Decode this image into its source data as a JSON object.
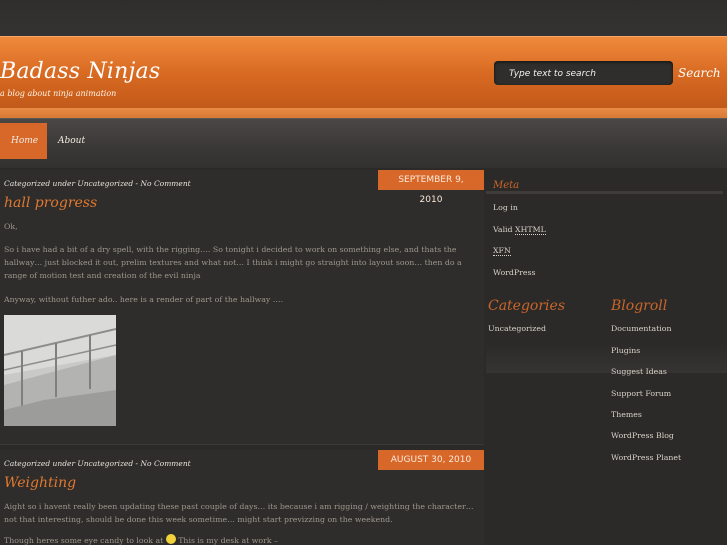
{
  "site": {
    "title": "Badass Ninjas",
    "tagline": "a blog about ninja animation"
  },
  "search": {
    "placeholder": "Type text to search",
    "button_label": "Search"
  },
  "nav": {
    "items": [
      {
        "label": "Home",
        "active": true
      },
      {
        "label": "About",
        "active": false
      }
    ]
  },
  "posts": [
    {
      "meta": "Categorized under Uncategorized - No Comment",
      "date": "SEPTEMBER 9, 2010",
      "title": "hall progress",
      "paragraphs": [
        "Ok,",
        "So i have had a bit of a dry spell, with the rigging…. So tonight i decided to work on something else, and thats the hallway… just blocked it out, prelim textures and what not… I think i might go straight into layout soon… then do a range of motion test and creation of the evil ninja",
        "Anyway, without futher ado.. here is a render of part of the hallway …."
      ]
    },
    {
      "meta": "Categorized under Uncategorized - No Comment",
      "date": "AUGUST 30, 2010",
      "title": "Weighting",
      "paragraphs": [
        "Aight so i havent really been updating these past couple of days… its because i am rigging / weighting the character… not that interesting, should be done this week sometime… might start previzzing on the weekend.",
        "Though heres some eye candy to look at",
        "This is my desk at work –"
      ]
    }
  ],
  "sidebar": {
    "meta": {
      "title": "Meta",
      "links": [
        "Log in",
        "Valid",
        "XHTML",
        "XFN",
        "WordPress"
      ]
    },
    "categories": {
      "title": "Categories",
      "items": [
        "Uncategorized"
      ]
    },
    "blogroll": {
      "title": "Blogroll",
      "items": [
        "Documentation",
        "Plugins",
        "Suggest Ideas",
        "Support Forum",
        "Themes",
        "WordPress Blog",
        "WordPress Planet"
      ]
    }
  },
  "colors": {
    "accent": "#d8682a",
    "header": "#e07a30",
    "background": "#2b2a28",
    "title_text": "#e0782f"
  }
}
